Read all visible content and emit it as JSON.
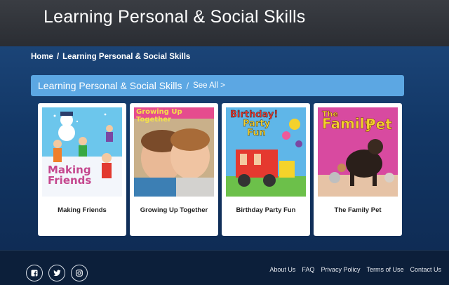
{
  "header": {
    "title": "Learning Personal & Social Skills"
  },
  "breadcrumb": {
    "home": "Home",
    "separator": "/",
    "current": "Learning Personal & Social Skills"
  },
  "section": {
    "title": "Learning Personal & Social Skills",
    "separator": "/",
    "see_all": "See All >"
  },
  "books": [
    {
      "title": "Making Friends",
      "cover_text": [
        "Making",
        "Friends"
      ]
    },
    {
      "title": "Growing Up Together",
      "cover_text": [
        "Growing Up",
        "Together"
      ]
    },
    {
      "title": "Birthday Party Fun",
      "cover_text": [
        "Birthday!",
        "Party",
        "Fun"
      ]
    },
    {
      "title": "The Family Pet",
      "cover_text": [
        "The",
        "Family",
        "Pet"
      ]
    }
  ],
  "footer": {
    "social": [
      "facebook-icon",
      "twitter-icon",
      "instagram-icon"
    ],
    "links": [
      "About Us",
      "FAQ",
      "Privacy Policy",
      "Terms of Use",
      "Contact Us"
    ]
  },
  "colors": {
    "accent": "#5ca7e3",
    "topbar": "#2f3238",
    "page": "#123766"
  }
}
